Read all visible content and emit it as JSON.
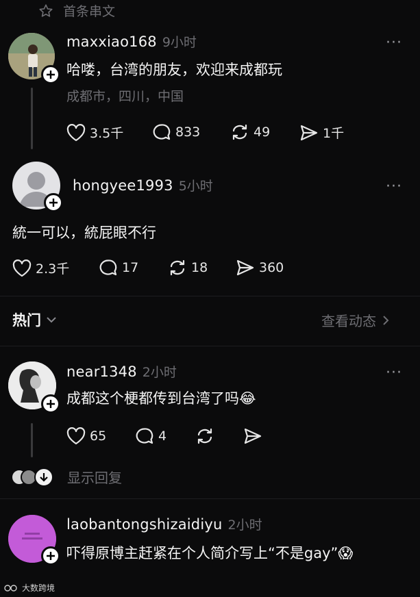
{
  "top": {
    "label": "首条串文"
  },
  "posts": [
    {
      "username": "maxxiao168",
      "time": "9小时",
      "text": "哈喽，台湾的朋友，欢迎来成都玩",
      "location": "成都市，四川，中国",
      "likes": "3.5千",
      "comments": "833",
      "reposts": "49",
      "shares": "1千"
    },
    {
      "username": "hongyee1993",
      "time": "5小时",
      "text": "統一可以，統屁眼不行",
      "likes": "2.3千",
      "comments": "17",
      "reposts": "18",
      "shares": "360"
    }
  ],
  "hot": {
    "label": "热门",
    "activity": "查看动态"
  },
  "replies": [
    {
      "username": "near1348",
      "time": "2小时",
      "text": "成都这个梗都传到台湾了吗",
      "emoji": "😂",
      "likes": "65",
      "comments": "4"
    },
    {
      "username": "laobantongshizaidiyu",
      "time": "2小时",
      "text": "吓得原博主赶紧在个人简介写上“不是gay”",
      "emoji": "😱"
    }
  ],
  "show_replies": "显示回复",
  "more": "···",
  "watermark": "大数跨境"
}
